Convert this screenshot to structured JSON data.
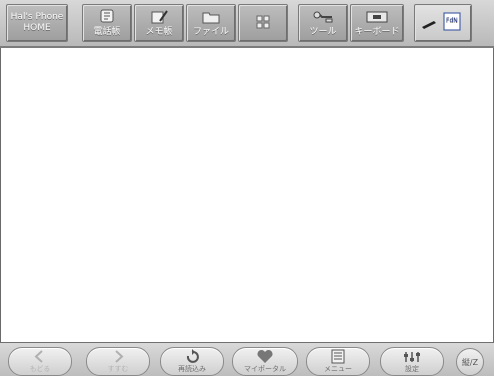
{
  "toolbar": {
    "home": {
      "line1": "Hal's Phone",
      "line2": "HOME"
    },
    "items": [
      {
        "label": "電話帳",
        "icon": "phonebook-icon"
      },
      {
        "label": "メモ帳",
        "icon": "memo-icon"
      },
      {
        "label": "ファイル",
        "icon": "folder-icon"
      },
      {
        "label": "",
        "icon": "grid-icon"
      },
      {
        "label": "ツール",
        "icon": "tool-icon"
      },
      {
        "label": "キーボード",
        "icon": "keyboard-icon"
      }
    ],
    "fn_label": "FdN"
  },
  "bottombar": {
    "back_label": "もどる",
    "forward_label": "すすむ",
    "reload_label": "再読込み",
    "portal_label": "マイポータル",
    "menu_label": "メニュー",
    "settings_label": "設定",
    "round_label": "縦/Z"
  }
}
